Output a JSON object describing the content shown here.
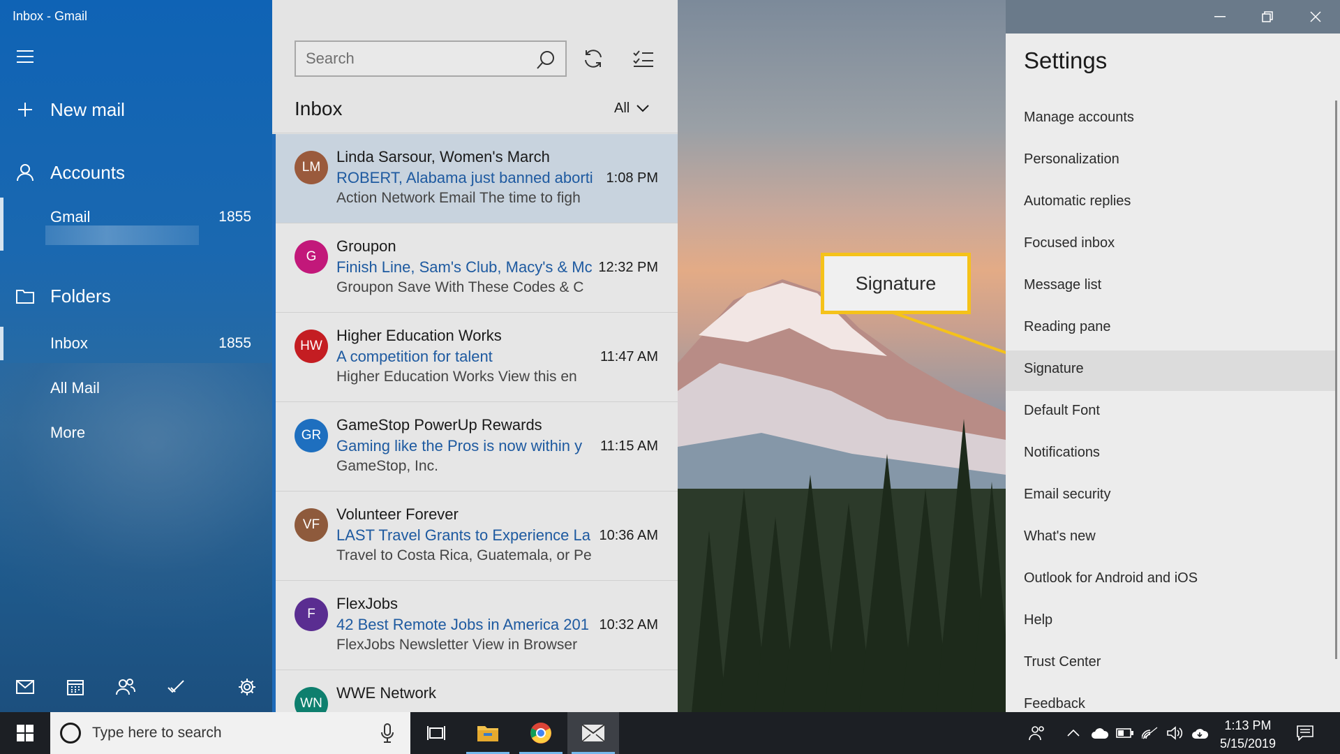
{
  "window": {
    "title": "Inbox - Gmail"
  },
  "nav": {
    "new_mail": "New mail",
    "accounts": "Accounts",
    "account": {
      "name": "Gmail",
      "count": "1855"
    },
    "folders": "Folders",
    "folder_items": [
      {
        "label": "Inbox",
        "count": "1855"
      },
      {
        "label": "All Mail",
        "count": ""
      },
      {
        "label": "More",
        "count": ""
      }
    ]
  },
  "list": {
    "search_placeholder": "Search",
    "title": "Inbox",
    "filter": "All",
    "messages": [
      {
        "initials": "LM",
        "color": "#9a5a3c",
        "from": "Linda Sarsour, Women's March",
        "subject": "ROBERT, Alabama just banned aborti",
        "time": "1:08 PM",
        "preview": "Action Network Email The time to figh"
      },
      {
        "initials": "G",
        "color": "#c2187a",
        "from": "Groupon",
        "subject": "Finish Line, Sam's Club, Macy's & Mc",
        "time": "12:32 PM",
        "preview": "Groupon Save With These Codes & C"
      },
      {
        "initials": "HW",
        "color": "#c41d22",
        "from": "Higher Education Works",
        "subject": "A competition for talent",
        "time": "11:47 AM",
        "preview": "Higher Education Works View this en"
      },
      {
        "initials": "GR",
        "color": "#1e6fbf",
        "from": "GameStop PowerUp Rewards",
        "subject": "Gaming like the Pros is now within y",
        "time": "11:15 AM",
        "preview": "GameStop, Inc."
      },
      {
        "initials": "VF",
        "color": "#8e5a3c",
        "from": "Volunteer Forever",
        "subject": "LAST Travel Grants to Experience La",
        "time": "10:36 AM",
        "preview": "Travel to Costa Rica, Guatemala, or Pe"
      },
      {
        "initials": "F",
        "color": "#5a2d91",
        "from": "FlexJobs",
        "subject": "42 Best Remote Jobs in America 201",
        "time": "10:32 AM",
        "preview": "FlexJobs Newsletter View in Browser"
      },
      {
        "initials": "WN",
        "color": "#0e7f6e",
        "from": "WWE Network",
        "subject": "",
        "time": "",
        "preview": ""
      }
    ]
  },
  "callout": {
    "label": "Signature"
  },
  "settings": {
    "title": "Settings",
    "items": [
      "Manage accounts",
      "Personalization",
      "Automatic replies",
      "Focused inbox",
      "Message list",
      "Reading pane",
      "Signature",
      "Default Font",
      "Notifications",
      "Email security",
      "What's new",
      "Outlook for Android and iOS",
      "Help",
      "Trust Center",
      "Feedback"
    ],
    "highlighted": "Signature"
  },
  "taskbar": {
    "search_placeholder": "Type here to search",
    "time": "1:13 PM",
    "date": "5/15/2019"
  },
  "icons": {
    "nav": [
      "hamburger-icon",
      "plus-icon",
      "person-icon",
      "folder-icon"
    ],
    "nav_bottom": [
      "mail-icon",
      "calendar-icon",
      "people-icon",
      "todo-icon",
      "gear-icon"
    ],
    "list_toolbar": [
      "search-icon",
      "sync-icon",
      "select-mode-icon",
      "chevron-down-icon"
    ],
    "window": [
      "minimize-icon",
      "restore-icon",
      "close-icon"
    ],
    "taskbar": [
      "windows-logo-icon",
      "cortana-icon",
      "microphone-icon",
      "task-view-icon",
      "file-explorer-icon",
      "chrome-icon",
      "mail-app-icon",
      "people-icon",
      "chevron-up-icon",
      "onedrive-icon",
      "battery-icon",
      "wifi-icon",
      "volume-icon",
      "cloud-sync-icon",
      "action-center-icon"
    ]
  }
}
